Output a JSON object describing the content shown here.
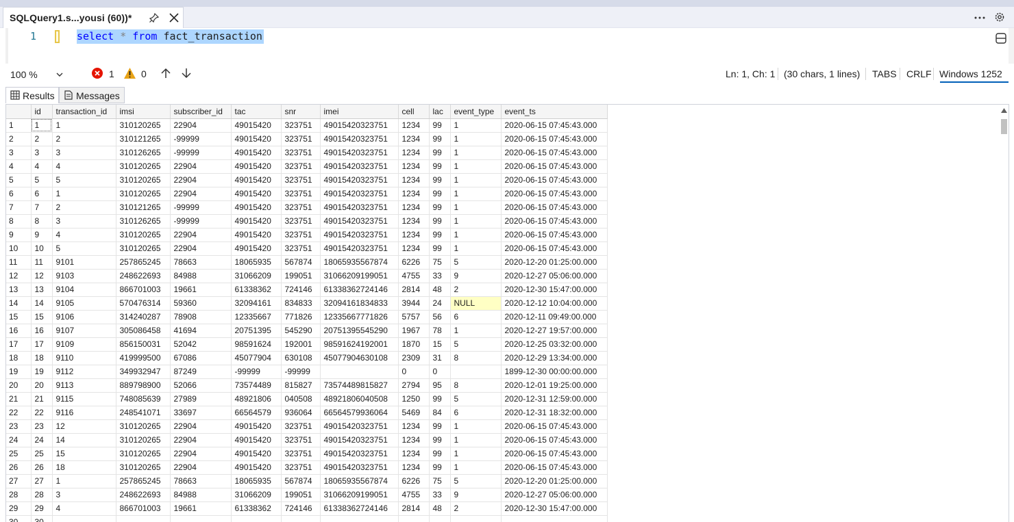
{
  "tab": {
    "title": "SQLQuery1.s...yousi (60))*"
  },
  "editor": {
    "line_number": "1",
    "code": {
      "kw1": "select",
      "star": "*",
      "kw2": "from",
      "table": "fact_transaction"
    }
  },
  "status": {
    "zoom": "100 %",
    "errors": "1",
    "warnings": "0",
    "position": "Ln: 1, Ch: 1",
    "chars": "(30 chars, 1 lines)",
    "indent": "TABS",
    "eol": "CRLF",
    "encoding": "Windows 1252"
  },
  "results_tabs": {
    "results": "Results",
    "messages": "Messages"
  },
  "grid": {
    "columns": [
      "id",
      "transaction_id",
      "imsi",
      "subscriber_id",
      "tac",
      "snr",
      "imei",
      "cell",
      "lac",
      "event_type",
      "event_ts"
    ],
    "rows": [
      [
        "1",
        "1",
        "1",
        "310120265",
        "22904",
        "49015420",
        "323751",
        "49015420323751",
        "1234",
        "99",
        "1",
        "2020-06-15 07:45:43.000"
      ],
      [
        "2",
        "2",
        "2",
        "310121265",
        "-99999",
        "49015420",
        "323751",
        "49015420323751",
        "1234",
        "99",
        "1",
        "2020-06-15 07:45:43.000"
      ],
      [
        "3",
        "3",
        "3",
        "310126265",
        "-99999",
        "49015420",
        "323751",
        "49015420323751",
        "1234",
        "99",
        "1",
        "2020-06-15 07:45:43.000"
      ],
      [
        "4",
        "4",
        "4",
        "310120265",
        "22904",
        "49015420",
        "323751",
        "49015420323751",
        "1234",
        "99",
        "1",
        "2020-06-15 07:45:43.000"
      ],
      [
        "5",
        "5",
        "5",
        "310120265",
        "22904",
        "49015420",
        "323751",
        "49015420323751",
        "1234",
        "99",
        "1",
        "2020-06-15 07:45:43.000"
      ],
      [
        "6",
        "6",
        "1",
        "310120265",
        "22904",
        "49015420",
        "323751",
        "49015420323751",
        "1234",
        "99",
        "1",
        "2020-06-15 07:45:43.000"
      ],
      [
        "7",
        "7",
        "2",
        "310121265",
        "-99999",
        "49015420",
        "323751",
        "49015420323751",
        "1234",
        "99",
        "1",
        "2020-06-15 07:45:43.000"
      ],
      [
        "8",
        "8",
        "3",
        "310126265",
        "-99999",
        "49015420",
        "323751",
        "49015420323751",
        "1234",
        "99",
        "1",
        "2020-06-15 07:45:43.000"
      ],
      [
        "9",
        "9",
        "4",
        "310120265",
        "22904",
        "49015420",
        "323751",
        "49015420323751",
        "1234",
        "99",
        "1",
        "2020-06-15 07:45:43.000"
      ],
      [
        "10",
        "10",
        "5",
        "310120265",
        "22904",
        "49015420",
        "323751",
        "49015420323751",
        "1234",
        "99",
        "1",
        "2020-06-15 07:45:43.000"
      ],
      [
        "11",
        "11",
        "9101",
        "257865245",
        "78663",
        "18065935",
        "567874",
        "18065935567874",
        "6226",
        "75",
        "5",
        "2020-12-20 01:25:00.000"
      ],
      [
        "12",
        "12",
        "9103",
        "248622693",
        "84988",
        "31066209",
        "199051",
        "31066209199051",
        "4755",
        "33",
        "9",
        "2020-12-27 05:06:00.000"
      ],
      [
        "13",
        "13",
        "9104",
        "866701003",
        "19661",
        "61338362",
        "724146",
        "61338362724146",
        "2814",
        "48",
        "2",
        "2020-12-30 15:47:00.000"
      ],
      [
        "14",
        "14",
        "9105",
        "570476314",
        "59360",
        "32094161",
        "834833",
        "32094161834833",
        "3944",
        "24",
        "NULL",
        "2020-12-12 10:04:00.000"
      ],
      [
        "15",
        "15",
        "9106",
        "314240287",
        "78908",
        "12335667",
        "771826",
        "12335667771826",
        "5757",
        "56",
        "6",
        "2020-12-11 09:49:00.000"
      ],
      [
        "16",
        "16",
        "9107",
        "305086458",
        "41694",
        "20751395",
        "545290",
        "20751395545290",
        "1967",
        "78",
        "1",
        "2020-12-27 19:57:00.000"
      ],
      [
        "17",
        "17",
        "9109",
        "856150031",
        "52042",
        "98591624",
        "192001",
        "98591624192001",
        "1870",
        "15",
        "5",
        "2020-12-25 03:32:00.000"
      ],
      [
        "18",
        "18",
        "9110",
        "419999500",
        "67086",
        "45077904",
        "630108",
        "45077904630108",
        "2309",
        "31",
        "8",
        "2020-12-29 13:34:00.000"
      ],
      [
        "19",
        "19",
        "9112",
        "349932947",
        "87249",
        "-99999",
        "-99999",
        "",
        "0",
        "0",
        "",
        "1899-12-30 00:00:00.000"
      ],
      [
        "20",
        "20",
        "9113",
        "889798900",
        "52066",
        "73574489",
        "815827",
        "73574489815827",
        "2794",
        "95",
        "8",
        "2020-12-01 19:25:00.000"
      ],
      [
        "21",
        "21",
        "9115",
        "748085639",
        "27989",
        "48921806",
        "040508",
        "48921806040508",
        "1250",
        "99",
        "5",
        "2020-12-31 12:59:00.000"
      ],
      [
        "22",
        "22",
        "9116",
        "248541071",
        "33697",
        "66564579",
        "936064",
        "66564579936064",
        "5469",
        "84",
        "6",
        "2020-12-31 18:32:00.000"
      ],
      [
        "23",
        "23",
        "12",
        "310120265",
        "22904",
        "49015420",
        "323751",
        "49015420323751",
        "1234",
        "99",
        "1",
        "2020-06-15 07:45:43.000"
      ],
      [
        "24",
        "24",
        "14",
        "310120265",
        "22904",
        "49015420",
        "323751",
        "49015420323751",
        "1234",
        "99",
        "1",
        "2020-06-15 07:45:43.000"
      ],
      [
        "25",
        "25",
        "15",
        "310120265",
        "22904",
        "49015420",
        "323751",
        "49015420323751",
        "1234",
        "99",
        "1",
        "2020-06-15 07:45:43.000"
      ],
      [
        "26",
        "26",
        "18",
        "310120265",
        "22904",
        "49015420",
        "323751",
        "49015420323751",
        "1234",
        "99",
        "1",
        "2020-06-15 07:45:43.000"
      ],
      [
        "27",
        "27",
        "1",
        "257865245",
        "78663",
        "18065935",
        "567874",
        "18065935567874",
        "6226",
        "75",
        "5",
        "2020-12-20 01:25:00.000"
      ],
      [
        "28",
        "28",
        "3",
        "248622693",
        "84988",
        "31066209",
        "199051",
        "31066209199051",
        "4755",
        "33",
        "9",
        "2020-12-27 05:06:00.000"
      ],
      [
        "29",
        "29",
        "4",
        "866701003",
        "19661",
        "61338362",
        "724146",
        "61338362724146",
        "2814",
        "48",
        "2",
        "2020-12-30 15:47:00.000"
      ],
      [
        "30",
        "30",
        "",
        "",
        "",
        "",
        "",
        "",
        "",
        "",
        "",
        ""
      ]
    ]
  }
}
